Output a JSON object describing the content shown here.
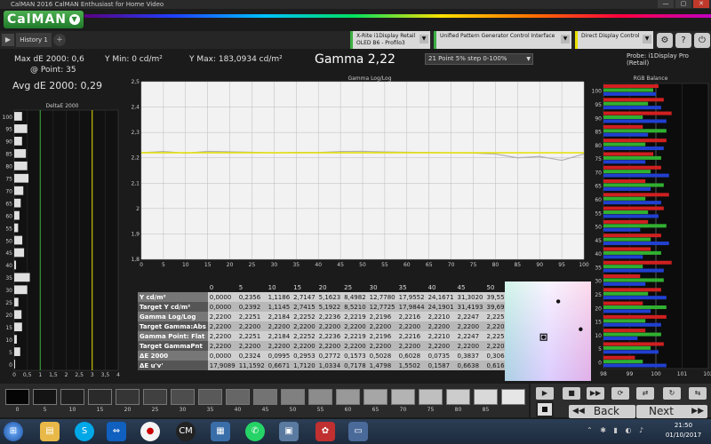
{
  "window": {
    "title": "CalMAN 2016 CalMAN Enthusiast for Home Video",
    "min": "—",
    "max": "▢",
    "close": "✕"
  },
  "app": {
    "logo": "CalMAN"
  },
  "tabs": [
    {
      "label": "History 1"
    }
  ],
  "devices": {
    "meter_line1": "X-Rite i1Display Retail",
    "meter_line2": "OLED B6 - Profilo3",
    "generator": "Unified Pattern Generator Control Interface",
    "display": "Direct Display Control"
  },
  "metrics": {
    "max_de": "Max dE 2000: 0,6",
    "at_point": "@ Point: 35",
    "avg_de": "Avg dE 2000: 0,29",
    "y_min": "Y Min: 0 cd/m²",
    "y_max": "Y Max: 183,0934 cd/m²",
    "gamma": "Gamma 2,22",
    "preset": "21 Point 5% step 0-100%",
    "probe": "Probe: i1Display Pro (Retail)"
  },
  "panels": {
    "deltae_title": "DeltaE 2000",
    "gamma_title": "Gamma Log/Log",
    "rgb_title": "RGB Balance"
  },
  "table": {
    "columns": [
      "0",
      "5",
      "10",
      "15",
      "20",
      "25",
      "30",
      "35",
      "40",
      "45",
      "50"
    ],
    "rows": [
      {
        "label": "Y cd/m²",
        "values": [
          "0,0000",
          "0,2356",
          "1,1186",
          "2,7147",
          "5,1623",
          "8,4982",
          "12,7780",
          "17,9552",
          "24,1671",
          "31,3020",
          "39,5501"
        ]
      },
      {
        "label": "Target Y cd/m²",
        "values": [
          "0,0000",
          "0,2392",
          "1,1145",
          "2,7415",
          "5,1922",
          "8,5210",
          "12,7725",
          "17,9844",
          "24,1901",
          "31,4193",
          "39,6989"
        ]
      },
      {
        "label": "Gamma Log/Log",
        "values": [
          "2,2200",
          "2,2251",
          "2,2184",
          "2,2252",
          "2,2236",
          "2,2219",
          "2,2196",
          "2,2216",
          "2,2210",
          "2,2247",
          "2,2255"
        ]
      },
      {
        "label": "Target Gamma:Abs",
        "values": [
          "2,2200",
          "2,2200",
          "2,2200",
          "2,2200",
          "2,2200",
          "2,2200",
          "2,2200",
          "2,2200",
          "2,2200",
          "2,2200",
          "2,2200"
        ]
      },
      {
        "label": "Gamma Point: Flat",
        "values": [
          "2,2200",
          "2,2251",
          "2,2184",
          "2,2252",
          "2,2236",
          "2,2219",
          "2,2196",
          "2,2216",
          "2,2210",
          "2,2247",
          "2,2255"
        ]
      },
      {
        "label": "Target GammaPnt",
        "values": [
          "2,2200",
          "2,2200",
          "2,2200",
          "2,2200",
          "2,2200",
          "2,2200",
          "2,2200",
          "2,2200",
          "2,2200",
          "2,2200",
          "2,2200"
        ]
      },
      {
        "label": "ΔE 2000",
        "values": [
          "0,0000",
          "0,2324",
          "0,0995",
          "0,2953",
          "0,2772",
          "0,1573",
          "0,5028",
          "0,6028",
          "0,0735",
          "0,3837",
          "0,3064"
        ]
      },
      {
        "label": "ΔE u'v'",
        "values": [
          "17,9089",
          "11,1592",
          "0,6671",
          "1,7120",
          "1,0334",
          "0,7178",
          "1,4798",
          "1,5502",
          "0,1587",
          "0,6638",
          "0,6163"
        ]
      }
    ]
  },
  "swatches": [
    {
      "label": "0",
      "color": "#050505"
    },
    {
      "label": "5",
      "color": "#141414"
    },
    {
      "label": "10",
      "color": "#1f1f1f"
    },
    {
      "label": "15",
      "color": "#2a2a2a"
    },
    {
      "label": "20",
      "color": "#353535"
    },
    {
      "label": "25",
      "color": "#404040"
    },
    {
      "label": "30",
      "color": "#4d4d4d"
    },
    {
      "label": "35",
      "color": "#595959"
    },
    {
      "label": "40",
      "color": "#666666"
    },
    {
      "label": "45",
      "color": "#737373"
    },
    {
      "label": "50",
      "color": "#808080"
    },
    {
      "label": "55",
      "color": "#8c8c8c"
    },
    {
      "label": "60",
      "color": "#999999"
    },
    {
      "label": "65",
      "color": "#a6a6a6"
    },
    {
      "label": "70",
      "color": "#b3b3b3"
    },
    {
      "label": "75",
      "color": "#bfbfbf"
    },
    {
      "label": "80",
      "color": "#cccccc"
    },
    {
      "label": "85",
      "color": "#d9d9d9"
    },
    {
      "label": "",
      "color": "#e6e6e6"
    }
  ],
  "nav": {
    "back": "Back",
    "next": "Next"
  },
  "clock": {
    "time": "21:50",
    "date": "01/10/2017"
  },
  "chart_data": [
    {
      "type": "bar",
      "title": "DeltaE 2000",
      "orientation": "horizontal",
      "categories": [
        "0",
        "5",
        "10",
        "15",
        "20",
        "25",
        "30",
        "35",
        "40",
        "45",
        "50",
        "55",
        "60",
        "65",
        "70",
        "75",
        "80",
        "85",
        "90",
        "95",
        "100"
      ],
      "values": [
        0.0,
        0.23,
        0.1,
        0.3,
        0.28,
        0.16,
        0.5,
        0.6,
        0.07,
        0.38,
        0.31,
        0.15,
        0.2,
        0.25,
        0.35,
        0.55,
        0.5,
        0.45,
        0.3,
        0.5,
        0.3
      ],
      "xlim": [
        0,
        4
      ],
      "x_ticks": [
        "0",
        "0,5",
        "1",
        "1,5",
        "2",
        "2,5",
        "3",
        "3,5",
        "4"
      ],
      "reference_lines": [
        {
          "x": 1,
          "color": "#3cb043"
        },
        {
          "x": 3,
          "color": "#e8e000"
        }
      ]
    },
    {
      "type": "line",
      "title": "Gamma Log/Log",
      "x": [
        0,
        5,
        10,
        15,
        20,
        25,
        30,
        35,
        40,
        45,
        50,
        55,
        60,
        65,
        70,
        75,
        80,
        85,
        90,
        95,
        100
      ],
      "series": [
        {
          "values": [
            2.22,
            2.2251,
            2.2184,
            2.2252,
            2.2236,
            2.2219,
            2.2196,
            2.2216,
            2.221,
            2.2247,
            2.2255,
            2.223,
            2.222,
            2.221,
            2.22,
            2.219,
            2.215,
            2.2,
            2.205,
            2.19,
            2.215
          ],
          "color": "#b0b0b0"
        },
        {
          "values": [
            2.22,
            2.22,
            2.22,
            2.22,
            2.22,
            2.22,
            2.22,
            2.22,
            2.22,
            2.22,
            2.22,
            2.22,
            2.22,
            2.22,
            2.22,
            2.22,
            2.22,
            2.22,
            2.22,
            2.22,
            2.22
          ],
          "color": "#e8e000"
        }
      ],
      "ylim": [
        1.8,
        2.5
      ],
      "y_ticks": [
        "1,8",
        "1,9",
        "2",
        "2,1",
        "2,2",
        "2,3",
        "2,4",
        "2,5"
      ],
      "x_ticks": [
        "0",
        "5",
        "10",
        "15",
        "20",
        "25",
        "30",
        "35",
        "40",
        "45",
        "50",
        "55",
        "60",
        "65",
        "70",
        "75",
        "80",
        "85",
        "90",
        "95",
        "100"
      ]
    },
    {
      "type": "bar",
      "title": "RGB Balance",
      "orientation": "horizontal",
      "categories": [
        "0",
        "5",
        "10",
        "15",
        "20",
        "25",
        "30",
        "35",
        "40",
        "45",
        "50",
        "55",
        "60",
        "65",
        "70",
        "75",
        "80",
        "85",
        "90",
        "95",
        "100"
      ],
      "series": [
        {
          "values": [
            99.2,
            100.3,
            99.6,
            100.4,
            99.5,
            100.2,
            99.4,
            100.6,
            99.8,
            100.2,
            99.7,
            100.3,
            100.5,
            99.6,
            100.2,
            99.9,
            100.4,
            99.5,
            100.6,
            100.3,
            100.1
          ],
          "color": "#d02020"
        },
        {
          "values": [
            99.5,
            99.8,
            100.2,
            99.6,
            100.4,
            99.7,
            100.3,
            99.5,
            100.2,
            99.8,
            100.4,
            99.7,
            99.6,
            100.3,
            99.8,
            100.2,
            99.6,
            100.4,
            99.5,
            99.7,
            99.9
          ],
          "color": "#30b030"
        },
        {
          "values": [
            100.4,
            100.1,
            99.3,
            100.2,
            99.8,
            100.4,
            99.6,
            100.3,
            99.5,
            100.5,
            99.4,
            100.1,
            100.2,
            99.8,
            100.5,
            99.6,
            100.3,
            99.7,
            100.4,
            100.2,
            100.0
          ],
          "color": "#2040d0"
        }
      ],
      "xlim": [
        98,
        102
      ],
      "x_ticks": [
        "98",
        "99",
        "100",
        "101",
        "102"
      ],
      "y_ticks": [
        "0",
        "5",
        "10",
        "15",
        "20",
        "25",
        "30",
        "35",
        "40",
        "45",
        "50",
        "55",
        "60",
        "65",
        "70",
        "75",
        "80",
        "85",
        "90",
        "95",
        "100"
      ]
    },
    {
      "type": "scatter",
      "title": "",
      "points": [
        {
          "u": 0.62,
          "v": 0.8
        },
        {
          "u": 0.88,
          "v": 0.52
        },
        {
          "u": 0.45,
          "v": 0.44
        }
      ],
      "target": {
        "u": 0.45,
        "v": 0.44
      }
    }
  ]
}
